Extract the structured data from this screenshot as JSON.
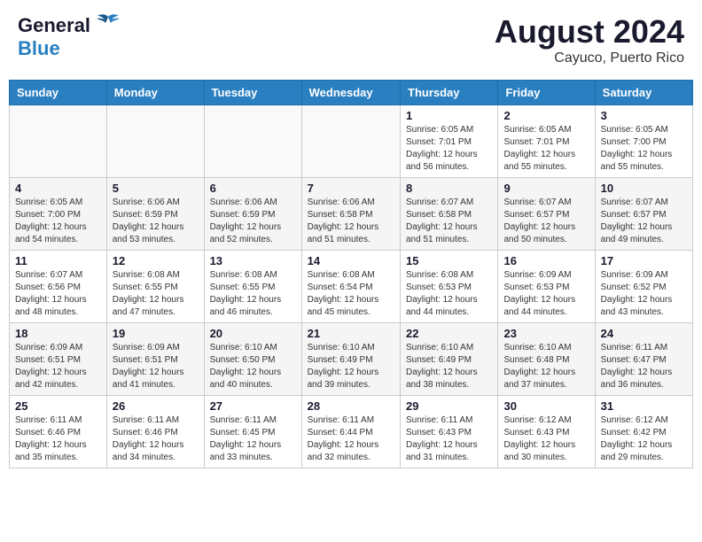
{
  "header": {
    "logo_general": "General",
    "logo_blue": "Blue",
    "main_title": "August 2024",
    "subtitle": "Cayuco, Puerto Rico"
  },
  "weekdays": [
    "Sunday",
    "Monday",
    "Tuesday",
    "Wednesday",
    "Thursday",
    "Friday",
    "Saturday"
  ],
  "weeks": [
    [
      {
        "day": "",
        "info": ""
      },
      {
        "day": "",
        "info": ""
      },
      {
        "day": "",
        "info": ""
      },
      {
        "day": "",
        "info": ""
      },
      {
        "day": "1",
        "info": "Sunrise: 6:05 AM\nSunset: 7:01 PM\nDaylight: 12 hours\nand 56 minutes."
      },
      {
        "day": "2",
        "info": "Sunrise: 6:05 AM\nSunset: 7:01 PM\nDaylight: 12 hours\nand 55 minutes."
      },
      {
        "day": "3",
        "info": "Sunrise: 6:05 AM\nSunset: 7:00 PM\nDaylight: 12 hours\nand 55 minutes."
      }
    ],
    [
      {
        "day": "4",
        "info": "Sunrise: 6:05 AM\nSunset: 7:00 PM\nDaylight: 12 hours\nand 54 minutes."
      },
      {
        "day": "5",
        "info": "Sunrise: 6:06 AM\nSunset: 6:59 PM\nDaylight: 12 hours\nand 53 minutes."
      },
      {
        "day": "6",
        "info": "Sunrise: 6:06 AM\nSunset: 6:59 PM\nDaylight: 12 hours\nand 52 minutes."
      },
      {
        "day": "7",
        "info": "Sunrise: 6:06 AM\nSunset: 6:58 PM\nDaylight: 12 hours\nand 51 minutes."
      },
      {
        "day": "8",
        "info": "Sunrise: 6:07 AM\nSunset: 6:58 PM\nDaylight: 12 hours\nand 51 minutes."
      },
      {
        "day": "9",
        "info": "Sunrise: 6:07 AM\nSunset: 6:57 PM\nDaylight: 12 hours\nand 50 minutes."
      },
      {
        "day": "10",
        "info": "Sunrise: 6:07 AM\nSunset: 6:57 PM\nDaylight: 12 hours\nand 49 minutes."
      }
    ],
    [
      {
        "day": "11",
        "info": "Sunrise: 6:07 AM\nSunset: 6:56 PM\nDaylight: 12 hours\nand 48 minutes."
      },
      {
        "day": "12",
        "info": "Sunrise: 6:08 AM\nSunset: 6:55 PM\nDaylight: 12 hours\nand 47 minutes."
      },
      {
        "day": "13",
        "info": "Sunrise: 6:08 AM\nSunset: 6:55 PM\nDaylight: 12 hours\nand 46 minutes."
      },
      {
        "day": "14",
        "info": "Sunrise: 6:08 AM\nSunset: 6:54 PM\nDaylight: 12 hours\nand 45 minutes."
      },
      {
        "day": "15",
        "info": "Sunrise: 6:08 AM\nSunset: 6:53 PM\nDaylight: 12 hours\nand 44 minutes."
      },
      {
        "day": "16",
        "info": "Sunrise: 6:09 AM\nSunset: 6:53 PM\nDaylight: 12 hours\nand 44 minutes."
      },
      {
        "day": "17",
        "info": "Sunrise: 6:09 AM\nSunset: 6:52 PM\nDaylight: 12 hours\nand 43 minutes."
      }
    ],
    [
      {
        "day": "18",
        "info": "Sunrise: 6:09 AM\nSunset: 6:51 PM\nDaylight: 12 hours\nand 42 minutes."
      },
      {
        "day": "19",
        "info": "Sunrise: 6:09 AM\nSunset: 6:51 PM\nDaylight: 12 hours\nand 41 minutes."
      },
      {
        "day": "20",
        "info": "Sunrise: 6:10 AM\nSunset: 6:50 PM\nDaylight: 12 hours\nand 40 minutes."
      },
      {
        "day": "21",
        "info": "Sunrise: 6:10 AM\nSunset: 6:49 PM\nDaylight: 12 hours\nand 39 minutes."
      },
      {
        "day": "22",
        "info": "Sunrise: 6:10 AM\nSunset: 6:49 PM\nDaylight: 12 hours\nand 38 minutes."
      },
      {
        "day": "23",
        "info": "Sunrise: 6:10 AM\nSunset: 6:48 PM\nDaylight: 12 hours\nand 37 minutes."
      },
      {
        "day": "24",
        "info": "Sunrise: 6:11 AM\nSunset: 6:47 PM\nDaylight: 12 hours\nand 36 minutes."
      }
    ],
    [
      {
        "day": "25",
        "info": "Sunrise: 6:11 AM\nSunset: 6:46 PM\nDaylight: 12 hours\nand 35 minutes."
      },
      {
        "day": "26",
        "info": "Sunrise: 6:11 AM\nSunset: 6:46 PM\nDaylight: 12 hours\nand 34 minutes."
      },
      {
        "day": "27",
        "info": "Sunrise: 6:11 AM\nSunset: 6:45 PM\nDaylight: 12 hours\nand 33 minutes."
      },
      {
        "day": "28",
        "info": "Sunrise: 6:11 AM\nSunset: 6:44 PM\nDaylight: 12 hours\nand 32 minutes."
      },
      {
        "day": "29",
        "info": "Sunrise: 6:11 AM\nSunset: 6:43 PM\nDaylight: 12 hours\nand 31 minutes."
      },
      {
        "day": "30",
        "info": "Sunrise: 6:12 AM\nSunset: 6:43 PM\nDaylight: 12 hours\nand 30 minutes."
      },
      {
        "day": "31",
        "info": "Sunrise: 6:12 AM\nSunset: 6:42 PM\nDaylight: 12 hours\nand 29 minutes."
      }
    ]
  ]
}
